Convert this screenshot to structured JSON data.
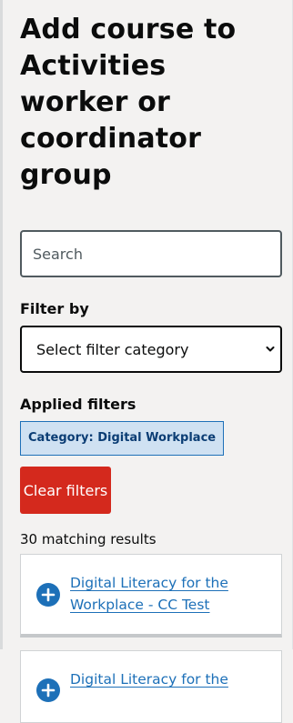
{
  "page": {
    "title": "Add course to Activities worker or coordinator group"
  },
  "search": {
    "placeholder": "Search"
  },
  "filter": {
    "label": "Filter by",
    "selected": "Select filter category"
  },
  "applied": {
    "label": "Applied filters",
    "chips": [
      {
        "text": "Category: Digital Workplace"
      }
    ],
    "clear_label": "Clear filters"
  },
  "results": {
    "count_text": "30 matching results",
    "items": [
      {
        "title": "Digital Literacy for the Workplace - CC Test",
        "icon": "add-circle-icon"
      },
      {
        "title": "Digital Literacy for the",
        "icon": "add-circle-icon"
      }
    ]
  },
  "colors": {
    "link": "#1d70b8",
    "danger": "#d4291d",
    "chip_bg": "#cfe1f2",
    "chip_border": "#1d70b8"
  }
}
